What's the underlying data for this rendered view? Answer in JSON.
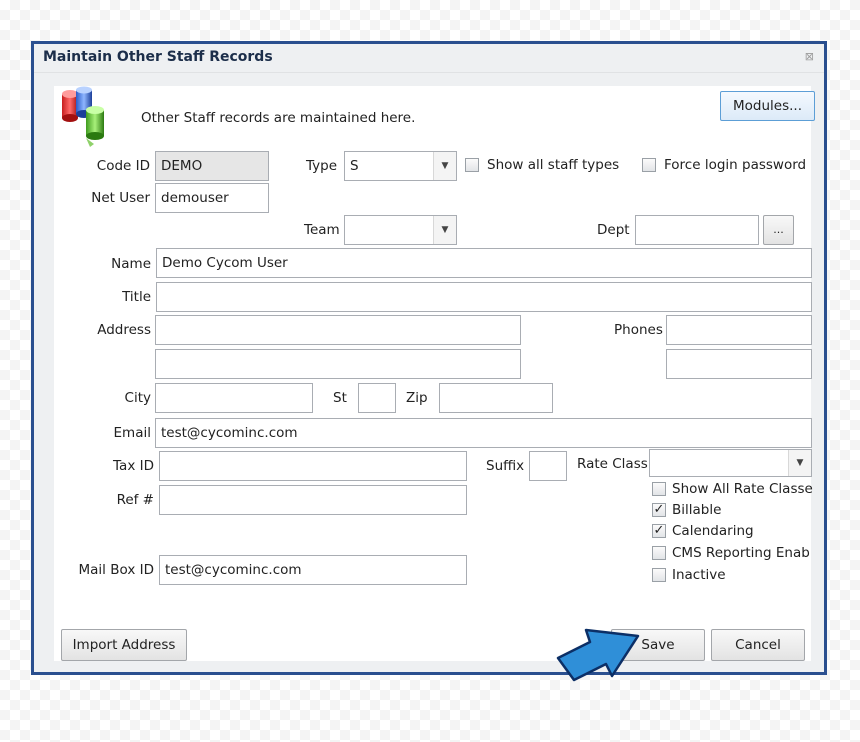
{
  "window": {
    "title": "Maintain Other Staff Records",
    "close_glyph": "⊠"
  },
  "header": {
    "intro": "Other Staff records are maintained here.",
    "modules_label": "Modules..."
  },
  "labels": {
    "code_id": "Code ID",
    "type": "Type",
    "net_user": "Net User",
    "team": "Team",
    "dept": "Dept",
    "name": "Name",
    "title": "Title",
    "address": "Address",
    "phones": "Phones",
    "city": "City",
    "st": "St",
    "zip": "Zip",
    "email": "Email",
    "tax_id": "Tax ID",
    "suffix": "Suffix",
    "rate_class": "Rate Class",
    "ref": "Ref #",
    "mail_box_id": "Mail Box ID"
  },
  "fields": {
    "code_id": "DEMO",
    "type": "S",
    "net_user": "demouser",
    "team": "",
    "dept": "",
    "name": "Demo Cycom User",
    "title": "",
    "address1": "",
    "address2": "",
    "phone1": "",
    "phone2": "",
    "city": "",
    "st": "",
    "zip": "",
    "email": "test@cycominc.com",
    "tax_id": "",
    "suffix": "",
    "rate_class": "",
    "ref": "",
    "mail_box_id": "test@cycominc.com"
  },
  "checkboxes": {
    "show_all_staff_types": {
      "label": "Show all staff types",
      "checked": false
    },
    "force_login_password": {
      "label": "Force login password",
      "checked": false
    },
    "show_all_rate_classes": {
      "label": "Show All Rate Classe",
      "checked": false
    },
    "billable": {
      "label": "Billable",
      "checked": true
    },
    "calendaring": {
      "label": "Calendaring",
      "checked": true
    },
    "cms_reporting": {
      "label": "CMS Reporting Enab",
      "checked": false
    },
    "inactive": {
      "label": "Inactive",
      "checked": false
    }
  },
  "buttons": {
    "dept_browse": "...",
    "import_address": "Import Address",
    "save": "Save",
    "cancel": "Cancel"
  },
  "colors": {
    "window_border": "#2a4f8f",
    "pointer_arrow": "#2f8fd8",
    "primary_button_border": "#5c9ed6"
  },
  "icons": {
    "app_logo": "staff-cylinders-icon",
    "pointer": "pointer-arrow-icon"
  }
}
